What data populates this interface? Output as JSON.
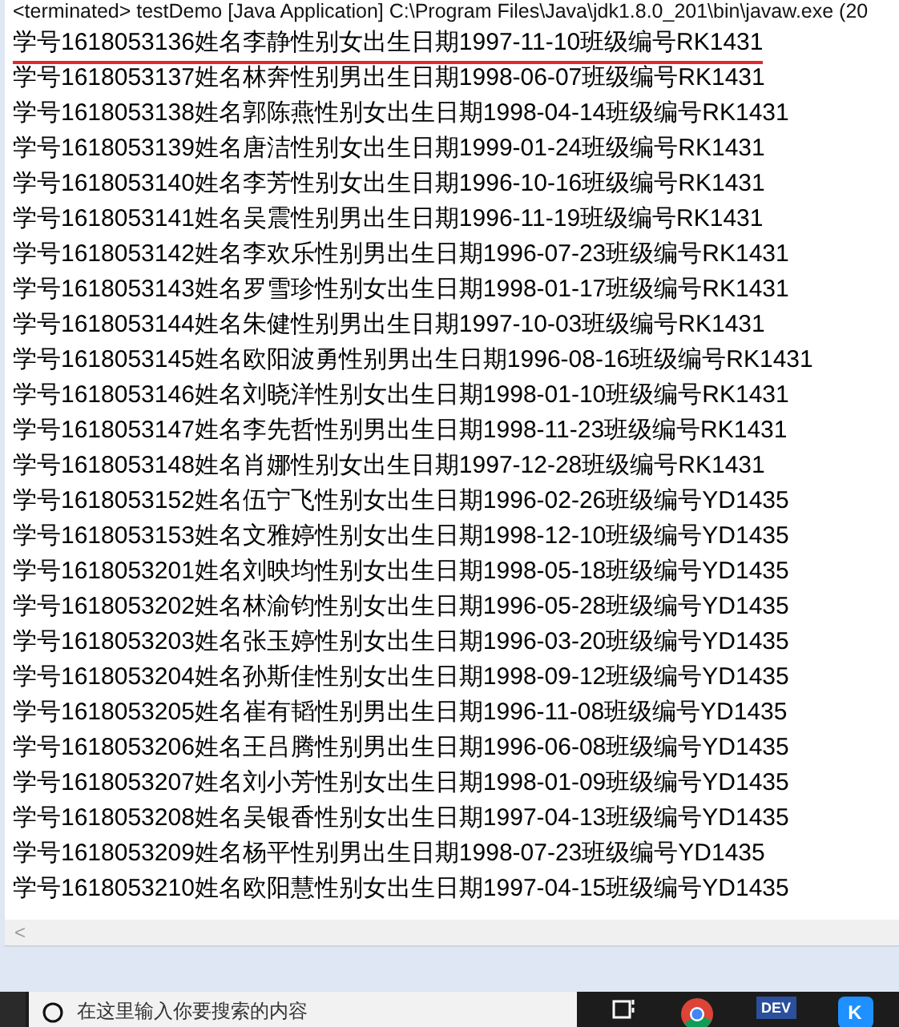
{
  "console": {
    "header": "<terminated> testDemo [Java Application] C:\\Program Files\\Java\\jdk1.8.0_201\\bin\\javaw.exe (20",
    "lines": [
      {
        "text": "学号1618053136姓名李静性别女出生日期1997-11-10班级编号RK1431",
        "underlined": true
      },
      {
        "text": "学号1618053137姓名林奔性别男出生日期1998-06-07班级编号RK1431",
        "underlined": false
      },
      {
        "text": "学号1618053138姓名郭陈燕性别女出生日期1998-04-14班级编号RK1431",
        "underlined": false
      },
      {
        "text": "学号1618053139姓名唐洁性别女出生日期1999-01-24班级编号RK1431",
        "underlined": false
      },
      {
        "text": "学号1618053140姓名李芳性别女出生日期1996-10-16班级编号RK1431",
        "underlined": false
      },
      {
        "text": "学号1618053141姓名吴震性别男出生日期1996-11-19班级编号RK1431",
        "underlined": false
      },
      {
        "text": "学号1618053142姓名李欢乐性别男出生日期1996-07-23班级编号RK1431",
        "underlined": false
      },
      {
        "text": "学号1618053143姓名罗雪珍性别女出生日期1998-01-17班级编号RK1431",
        "underlined": false
      },
      {
        "text": "学号1618053144姓名朱健性别男出生日期1997-10-03班级编号RK1431",
        "underlined": false
      },
      {
        "text": "学号1618053145姓名欧阳波勇性别男出生日期1996-08-16班级编号RK1431",
        "underlined": false
      },
      {
        "text": "学号1618053146姓名刘晓洋性别女出生日期1998-01-10班级编号RK1431",
        "underlined": false
      },
      {
        "text": "学号1618053147姓名李先哲性别男出生日期1998-11-23班级编号RK1431",
        "underlined": false
      },
      {
        "text": "学号1618053148姓名肖娜性别女出生日期1997-12-28班级编号RK1431",
        "underlined": false
      },
      {
        "text": "学号1618053152姓名伍宁飞性别女出生日期1996-02-26班级编号YD1435",
        "underlined": false
      },
      {
        "text": "学号1618053153姓名文雅婷性别女出生日期1998-12-10班级编号YD1435",
        "underlined": false
      },
      {
        "text": "学号1618053201姓名刘映均性别女出生日期1998-05-18班级编号YD1435",
        "underlined": false
      },
      {
        "text": "学号1618053202姓名林渝钧性别女出生日期1996-05-28班级编号YD1435",
        "underlined": false
      },
      {
        "text": "学号1618053203姓名张玉婷性别女出生日期1996-03-20班级编号YD1435",
        "underlined": false
      },
      {
        "text": "学号1618053204姓名孙斯佳性别女出生日期1998-09-12班级编号YD1435",
        "underlined": false
      },
      {
        "text": "学号1618053205姓名崔有韬性别男出生日期1996-11-08班级编号YD1435",
        "underlined": false
      },
      {
        "text": "学号1618053206姓名王吕腾性别男出生日期1996-06-08班级编号YD1435",
        "underlined": false
      },
      {
        "text": "学号1618053207姓名刘小芳性别女出生日期1998-01-09班级编号YD1435",
        "underlined": false
      },
      {
        "text": "学号1618053208姓名吴银香性别女出生日期1997-04-13班级编号YD1435",
        "underlined": false
      },
      {
        "text": "学号1618053209姓名杨平性别男出生日期1998-07-23班级编号YD1435",
        "underlined": false
      },
      {
        "text": "学号1618053210姓名欧阳慧性别女出生日期1997-04-15班级编号YD1435",
        "underlined": false
      }
    ],
    "scroll_left": "<"
  },
  "taskbar": {
    "search_placeholder": "在这里输入你要搜索的内容",
    "apps": [
      {
        "kind": "taskview"
      },
      {
        "kind": "browser"
      },
      {
        "kind": "dev",
        "label": "DEV"
      },
      {
        "kind": "k",
        "label": "K"
      }
    ]
  }
}
